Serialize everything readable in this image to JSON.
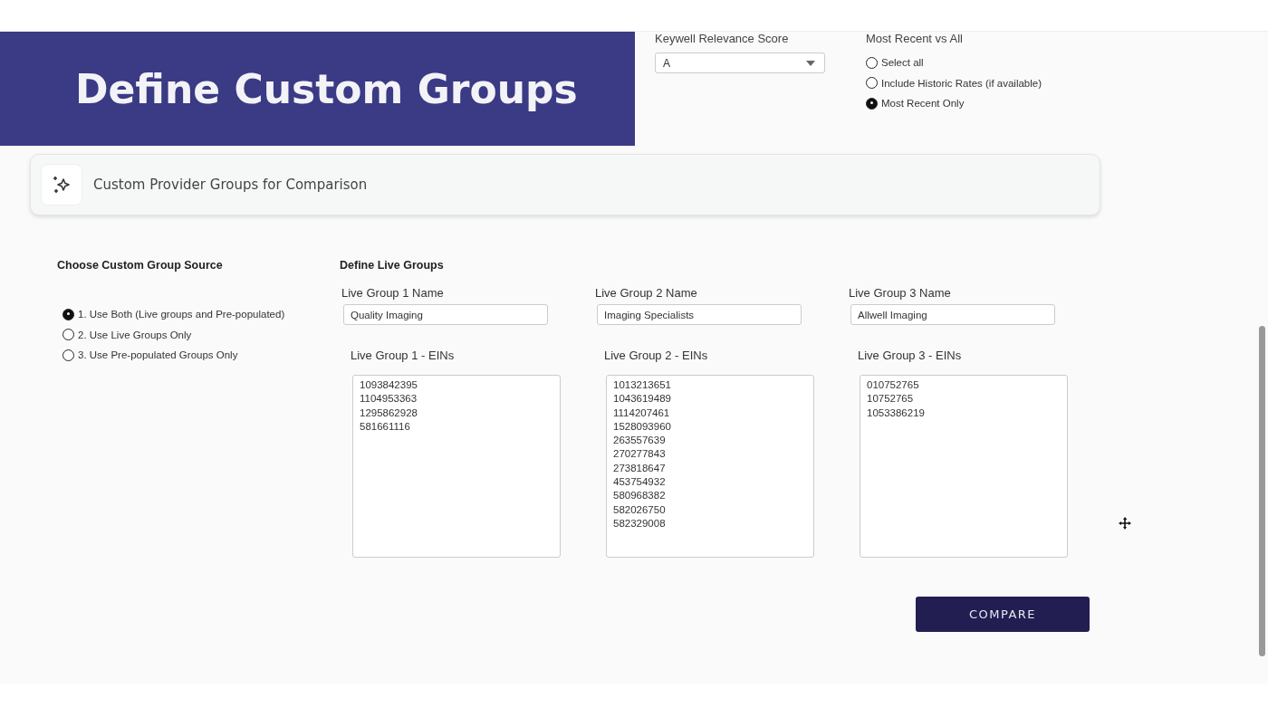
{
  "banner": {
    "title": "Define Custom Groups"
  },
  "relevance": {
    "label": "Keywell Relevance Score",
    "value": "A"
  },
  "recency": {
    "label": "Most Recent vs All",
    "options": [
      {
        "label": "Select all",
        "selected": false
      },
      {
        "label": "Include Historic Rates (if available)",
        "selected": false
      },
      {
        "label": "Most Recent Only",
        "selected": true
      }
    ]
  },
  "section": {
    "title": "Custom Provider Groups for Comparison"
  },
  "source": {
    "title": "Choose Custom Group Source",
    "options": [
      {
        "label": "1. Use Both (Live groups and Pre-populated)",
        "selected": true
      },
      {
        "label": "2. Use Live Groups Only",
        "selected": false
      },
      {
        "label": "3. Use Pre-populated Groups Only",
        "selected": false
      }
    ]
  },
  "live_groups": {
    "title": "Define Live Groups",
    "groups": [
      {
        "name_label": "Live Group 1 Name",
        "name": "Quality Imaging",
        "eins_label": "Live Group 1 - EINs",
        "eins": [
          "1093842395",
          "1104953363",
          "1295862928",
          "581661116"
        ]
      },
      {
        "name_label": "Live Group 2 Name",
        "name": "Imaging Specialists",
        "eins_label": "Live Group 2 - EINs",
        "eins": [
          "1013213651",
          "1043619489",
          "1114207461",
          "1528093960",
          "263557639",
          "270277843",
          "273818647",
          "453754932",
          "580968382",
          "582026750",
          "582329008"
        ]
      },
      {
        "name_label": "Live Group 3 Name",
        "name": "Allwell Imaging",
        "eins_label": "Live Group 3 - EINs",
        "eins": [
          "010752765",
          "10752765",
          "1053386219"
        ]
      }
    ]
  },
  "compare_button": "COMPARE"
}
